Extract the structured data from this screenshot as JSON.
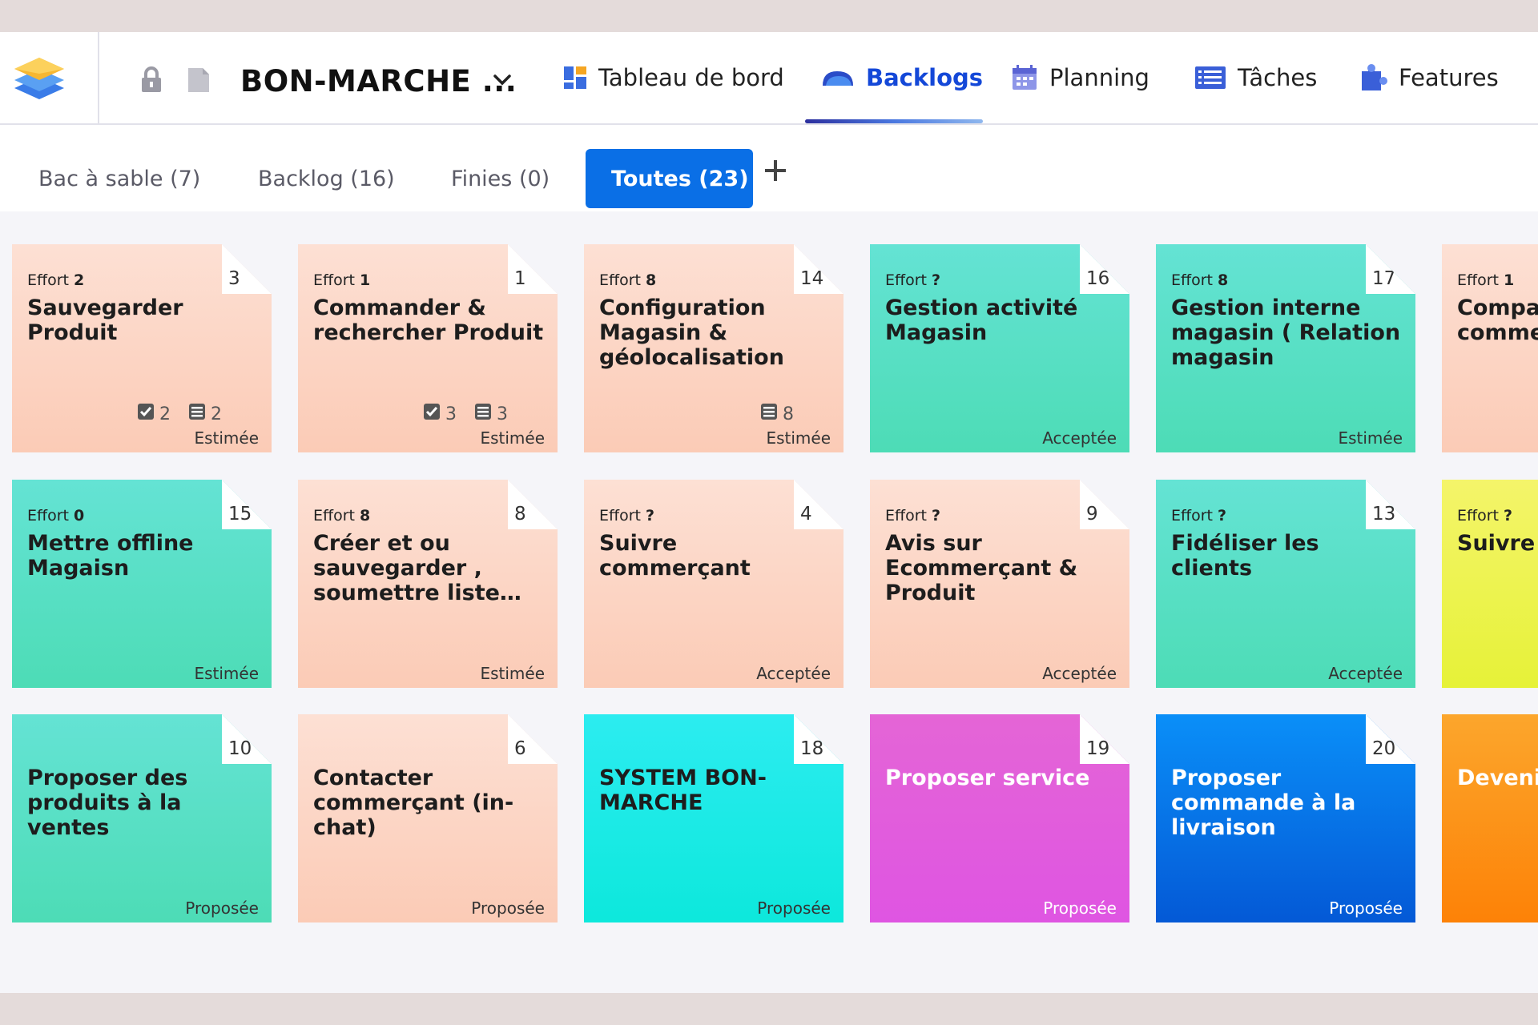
{
  "header": {
    "project_name": "BON-MARCHE ...",
    "nav": [
      {
        "label": "Tableau de bord",
        "icon": "dashboard-icon"
      },
      {
        "label": "Backlogs",
        "icon": "backlogs-icon",
        "active": true
      },
      {
        "label": "Planning",
        "icon": "calendar-icon"
      },
      {
        "label": "Tâches",
        "icon": "tasks-icon"
      },
      {
        "label": "Features",
        "icon": "puzzle-icon"
      }
    ]
  },
  "tabs": [
    {
      "label": "Bac à sable (7)"
    },
    {
      "label": "Backlog (16)"
    },
    {
      "label": "Finies (0)"
    },
    {
      "label": "Toutes (23)",
      "active": true
    }
  ],
  "cards": [
    {
      "effort_label": "Effort",
      "effort": "2",
      "number": "3",
      "title": "Sauvegarder Produit",
      "status": "Estimée",
      "color": "peach",
      "checks": "2",
      "lists": "2"
    },
    {
      "effort_label": "Effort",
      "effort": "1",
      "number": "1",
      "title": "Commander & rechercher Produit",
      "status": "Estimée",
      "color": "peach",
      "checks": "3",
      "lists": "3"
    },
    {
      "effort_label": "Effort",
      "effort": "8",
      "number": "14",
      "title": "Configuration Magasin & géolocalisation",
      "status": "Estimée",
      "color": "peach",
      "lists": "8"
    },
    {
      "effort_label": "Effort",
      "effort": "?",
      "number": "16",
      "title": "Gestion activité Magasin",
      "status": "Acceptée",
      "color": "teal"
    },
    {
      "effort_label": "Effort",
      "effort": "8",
      "number": "17",
      "title": "Gestion interne magasin ( Relation magasin Fournisseur)",
      "status": "Estimée",
      "color": "teal"
    },
    {
      "effort_label": "Effort",
      "effort": "1",
      "number": "",
      "title": "Comparer E-commerce",
      "status": "",
      "color": "peach"
    },
    {
      "effort_label": "Effort",
      "effort": "0",
      "number": "15",
      "title": "Mettre offline Magaisn",
      "status": "Estimée",
      "color": "teal"
    },
    {
      "effort_label": "Effort",
      "effort": "8",
      "number": "8",
      "title": "Créer et ou sauvegarder , soumettre liste…",
      "status": "Estimée",
      "color": "peach"
    },
    {
      "effort_label": "Effort",
      "effort": "?",
      "number": "4",
      "title": "Suivre commerçant",
      "status": "Acceptée",
      "color": "peach"
    },
    {
      "effort_label": "Effort",
      "effort": "?",
      "number": "9",
      "title": "Avis sur Ecommerçant & Produit",
      "status": "Acceptée",
      "color": "peach"
    },
    {
      "effort_label": "Effort",
      "effort": "?",
      "number": "13",
      "title": "Fidéliser les clients",
      "status": "Acceptée",
      "color": "teal"
    },
    {
      "effort_label": "Effort",
      "effort": "?",
      "number": "",
      "title": "Suivre c",
      "status": "",
      "color": "yellow"
    },
    {
      "effort_label": "",
      "effort": "",
      "number": "10",
      "title": "Proposer des produits à la ventes",
      "status": "Proposée",
      "color": "teal"
    },
    {
      "effort_label": "",
      "effort": "",
      "number": "6",
      "title": "Contacter commerçant (in-chat)",
      "status": "Proposée",
      "color": "peach"
    },
    {
      "effort_label": "",
      "effort": "",
      "number": "18",
      "title": "SYSTEM BON-MARCHE",
      "status": "Proposée",
      "color": "cyan"
    },
    {
      "effort_label": "",
      "effort": "",
      "number": "19",
      "title": "Proposer service",
      "status": "Proposée",
      "color": "magenta",
      "light": true
    },
    {
      "effort_label": "",
      "effort": "",
      "number": "20",
      "title": "Proposer commande à la livraison",
      "status": "Proposée",
      "color": "blue",
      "light": true
    },
    {
      "effort_label": "",
      "effort": "",
      "number": "",
      "title": "Devenir",
      "status": "",
      "color": "orange",
      "light": true
    }
  ]
}
